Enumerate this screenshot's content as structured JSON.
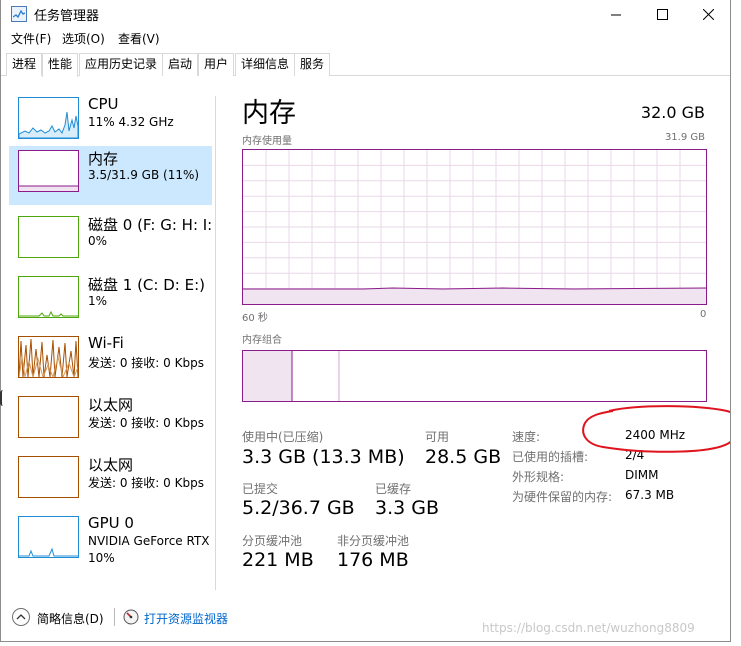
{
  "window": {
    "title": "任务管理器"
  },
  "menu": [
    "文件(F)",
    "选项(O)",
    "查看(V)"
  ],
  "tabs": [
    "进程",
    "性能",
    "应用历史记录",
    "启动",
    "用户",
    "详细信息",
    "服务"
  ],
  "active_tab": "性能",
  "sidebar": {
    "items": [
      {
        "name": "CPU",
        "detail": "11% 4.32 GHz",
        "detail2": "",
        "color": "#1f8dd6"
      },
      {
        "name": "内存",
        "detail": "3.5/31.9 GB (11%)",
        "detail2": "",
        "color": "#8b1a8b"
      },
      {
        "name": "磁盘 0 (F: G: H: I:",
        "detail": "0%",
        "detail2": "",
        "color": "#4da60c"
      },
      {
        "name": "磁盘 1 (C: D: E:)",
        "detail": "1%",
        "detail2": "",
        "color": "#4da60c"
      },
      {
        "name": "Wi-Fi",
        "detail": "发送: 0 接收: 0 Kbps",
        "detail2": "",
        "color": "#a74f01"
      },
      {
        "name": "以太网",
        "detail": "发送: 0 接收: 0 Kbps",
        "detail2": "",
        "color": "#a74f01"
      },
      {
        "name": "以太网",
        "detail": "发送: 0 接收: 0 Kbps",
        "detail2": "",
        "color": "#a74f01"
      },
      {
        "name": "GPU 0",
        "detail": "NVIDIA GeForce RTX",
        "detail2": "10%",
        "color": "#1f8dd6"
      }
    ]
  },
  "main": {
    "title": "内存",
    "total": "32.0 GB",
    "usage_label": "内存使用量",
    "usage_max": "31.9 GB",
    "axis_left": "60 秒",
    "axis_right": "0",
    "composition_label": "内存组合",
    "stats": {
      "in_use_label": "使用中(已压缩)",
      "in_use_value": "3.3 GB (13.3 MB)",
      "available_label": "可用",
      "available_value": "28.5 GB",
      "committed_label": "已提交",
      "committed_value": "5.2/36.7 GB",
      "cached_label": "已缓存",
      "cached_value": "3.3 GB",
      "paged_label": "分页缓冲池",
      "paged_value": "221 MB",
      "nonpaged_label": "非分页缓冲池",
      "nonpaged_value": "176 MB"
    },
    "specs": {
      "speed_label": "速度:",
      "speed_value": "2400 MHz",
      "slots_label": "已使用的插槽:",
      "slots_value": "2/4",
      "form_label": "外形规格:",
      "form_value": "DIMM",
      "reserved_label": "为硬件保留的内存:",
      "reserved_value": "67.3 MB"
    },
    "memory_usage_fraction": 0.11,
    "accent_color": "#8b1a8b",
    "annotation_color": "#e0141e"
  },
  "footer": {
    "fewer_details": "简略信息(D)",
    "open_monitor": "打开资源监视器"
  },
  "watermark": "https://blog.csdn.net/wuzhong8809"
}
